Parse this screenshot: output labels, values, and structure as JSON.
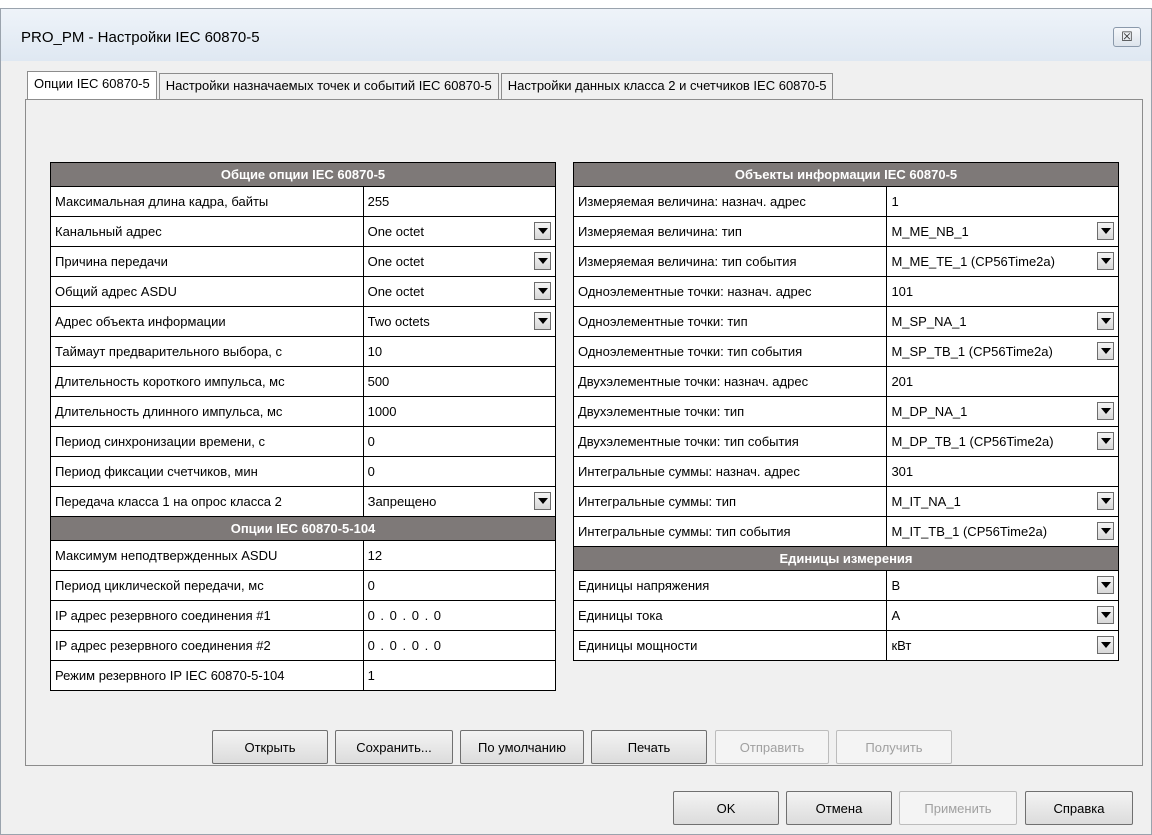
{
  "window": {
    "title": "PRO_PM - Настройки IEC 60870-5",
    "close_symbol": "☒"
  },
  "tabs": [
    {
      "label": "Опции IEC 60870-5"
    },
    {
      "label": "Настройки назначаемых точек и событий IEC 60870-5"
    },
    {
      "label": "Настройки данных класса 2 и счетчиков IEC 60870-5"
    }
  ],
  "general": {
    "header": "Общие опции IEC 60870-5",
    "rows": [
      {
        "label": "Максимальная длина кадра, байты",
        "value": "255"
      },
      {
        "label": "Канальный адрес",
        "value": "One octet"
      },
      {
        "label": "Причина передачи",
        "value": "One octet"
      },
      {
        "label": "Общий адрес ASDU",
        "value": "One octet"
      },
      {
        "label": "Адрес объекта информации",
        "value": "Two octets"
      },
      {
        "label": "Таймаут предварительного выбора, с",
        "value": "10"
      },
      {
        "label": "Длительность короткого импульса, мс",
        "value": "500"
      },
      {
        "label": "Длительность длинного импульса, мс",
        "value": "1000"
      },
      {
        "label": "Период синхронизации времени, с",
        "value": "0"
      },
      {
        "label": "Период фиксации счетчиков, мин",
        "value": "0"
      },
      {
        "label": "Передача класса 1 на опрос класса 2",
        "value": "Запрещено"
      }
    ]
  },
  "opts104": {
    "header": "Опции IEC 60870-5-104",
    "rows": [
      {
        "label": "Максимум неподтвержденных ASDU",
        "value": "12"
      },
      {
        "label": "Период циклической передачи, мс",
        "value": "0"
      },
      {
        "label": "IP адрес резервного соединения #1",
        "value": "0  .  0  .  0  .  0"
      },
      {
        "label": "IP адрес резервного соединения #2",
        "value": "0  .  0  .  0  .  0"
      },
      {
        "label": "Режим резервного IP IEC 60870-5-104",
        "value": "1"
      }
    ]
  },
  "objects": {
    "header": "Объекты информации IEC 60870-5",
    "rows": [
      {
        "label": "Измеряемая величина: назнач. адрес",
        "value": "1"
      },
      {
        "label": "Измеряемая величина: тип",
        "value": "M_ME_NB_1"
      },
      {
        "label": "Измеряемая величина: тип события",
        "value": "M_ME_TE_1 (CP56Time2a)"
      },
      {
        "label": "Одноэлементные точки: назнач. адрес",
        "value": "101"
      },
      {
        "label": "Одноэлементные точки: тип",
        "value": "M_SP_NA_1"
      },
      {
        "label": "Одноэлементные точки: тип события",
        "value": "M_SP_TB_1 (CP56Time2a)"
      },
      {
        "label": "Двухэлементные точки: назнач. адрес",
        "value": "201"
      },
      {
        "label": "Двухэлементные точки: тип",
        "value": "M_DP_NA_1"
      },
      {
        "label": "Двухэлементные точки: тип события",
        "value": "M_DP_TB_1 (CP56Time2a)"
      },
      {
        "label": "Интегральные суммы: назнач. адрес",
        "value": "301"
      },
      {
        "label": "Интегральные суммы: тип",
        "value": "M_IT_NA_1"
      },
      {
        "label": "Интегральные суммы: тип события",
        "value": "M_IT_TB_1 (CP56Time2a)"
      }
    ]
  },
  "units": {
    "header": "Единицы измерения",
    "rows": [
      {
        "label": "Единицы напряжения",
        "value": "В"
      },
      {
        "label": "Единицы тока",
        "value": "А"
      },
      {
        "label": "Единицы мощности",
        "value": "кВт"
      }
    ]
  },
  "panel_buttons": {
    "open": "Открыть",
    "save": "Сохранить...",
    "defaults": "По умолчанию",
    "print": "Печать",
    "send": "Отправить",
    "receive": "Получить"
  },
  "dialog_buttons": {
    "ok": "OK",
    "cancel": "Отмена",
    "apply": "Применить",
    "help": "Справка"
  }
}
